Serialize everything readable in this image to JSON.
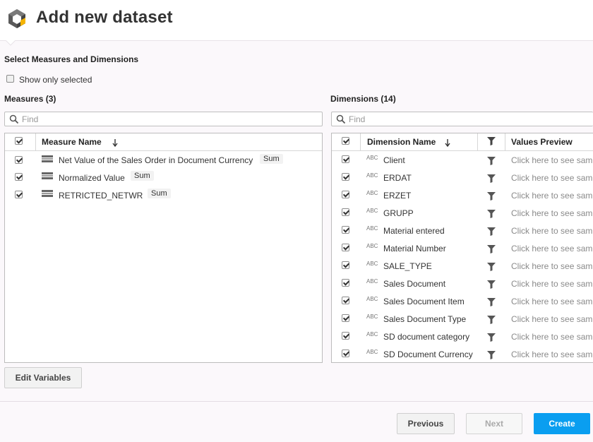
{
  "header": {
    "title": "Add new dataset",
    "logo_icon": "cube-logo-icon"
  },
  "section_title": "Select Measures and Dimensions",
  "show_only_selected": {
    "label": "Show only selected",
    "checked": false
  },
  "measures": {
    "title": "Measures (3)",
    "search_placeholder": "Find",
    "column_header": "Measure Name",
    "rows": [
      {
        "name": "Net Value of the Sales Order in Document Currency",
        "aggregation": "Sum",
        "checked": true
      },
      {
        "name": "Normalized Value",
        "aggregation": "Sum",
        "checked": true
      },
      {
        "name": "RETRICTED_NETWR",
        "aggregation": "Sum",
        "checked": true
      }
    ]
  },
  "dimensions": {
    "title": "Dimensions (14)",
    "search_placeholder": "Find",
    "column_header": "Dimension Name",
    "preview_header": "Values Preview",
    "type_label": "ABC",
    "preview_text": "Click here to see sam",
    "rows": [
      {
        "name": "Client",
        "checked": true
      },
      {
        "name": "ERDAT",
        "checked": true
      },
      {
        "name": "ERZET",
        "checked": true
      },
      {
        "name": "GRUPP",
        "checked": true
      },
      {
        "name": "Material entered",
        "checked": true
      },
      {
        "name": "Material Number",
        "checked": true
      },
      {
        "name": "SALE_TYPE",
        "checked": true
      },
      {
        "name": "Sales Document",
        "checked": true
      },
      {
        "name": "Sales Document Item",
        "checked": true
      },
      {
        "name": "Sales Document Type",
        "checked": true
      },
      {
        "name": "SD document category",
        "checked": true
      },
      {
        "name": "SD Document Currency",
        "checked": true
      }
    ]
  },
  "buttons": {
    "edit_variables": "Edit Variables",
    "previous": "Previous",
    "next": "Next",
    "create": "Create"
  },
  "colors": {
    "primary": "#0a9ef0",
    "background": "#fbf8fb"
  }
}
